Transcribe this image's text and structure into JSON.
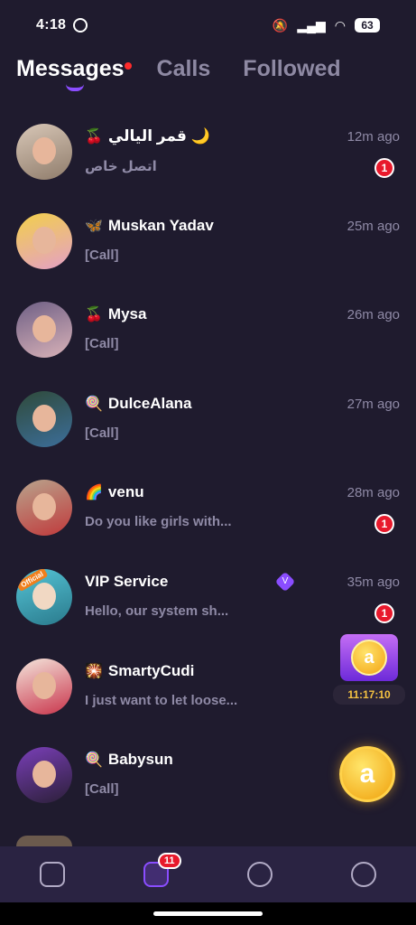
{
  "status": {
    "time": "4:18",
    "battery": "63"
  },
  "tabs": [
    {
      "label": "Messages",
      "active": true
    },
    {
      "label": "Calls",
      "active": false
    },
    {
      "label": "Followed",
      "active": false
    }
  ],
  "messages": [
    {
      "emoji": "🍒",
      "name": "قمر اليالي 🌙",
      "preview": "اتصل خاص",
      "time": "12m ago",
      "badge": "1"
    },
    {
      "emoji": "🦋",
      "name": "Muskan Yadav",
      "preview": "[Call]",
      "time": "25m ago",
      "badge": ""
    },
    {
      "emoji": "🍒",
      "name": "Mysa",
      "preview": "[Call]",
      "time": "26m ago",
      "badge": ""
    },
    {
      "emoji": "🍭",
      "name": "DulceAlana",
      "preview": "[Call]",
      "time": "27m ago",
      "badge": ""
    },
    {
      "emoji": "🌈",
      "name": "venu",
      "preview": "Do you like girls with...",
      "time": "28m ago",
      "badge": "1"
    },
    {
      "emoji": "",
      "name": "VIP Service",
      "preview": "Hello, our system sh...",
      "time": "35m ago",
      "badge": "1"
    },
    {
      "emoji": "🎇",
      "name": "SmartyCudi",
      "preview": "I just want to let loose...",
      "time": "",
      "badge": ""
    },
    {
      "emoji": "🍭",
      "name": "Babysun",
      "preview": "[Call]",
      "time": "",
      "badge": ""
    }
  ],
  "vip": {
    "official_tag": "Official",
    "check_icon": "V"
  },
  "promo": {
    "timer": "11:17:10",
    "coin_symbol": "a"
  },
  "nav": {
    "messages_badge": "11"
  }
}
